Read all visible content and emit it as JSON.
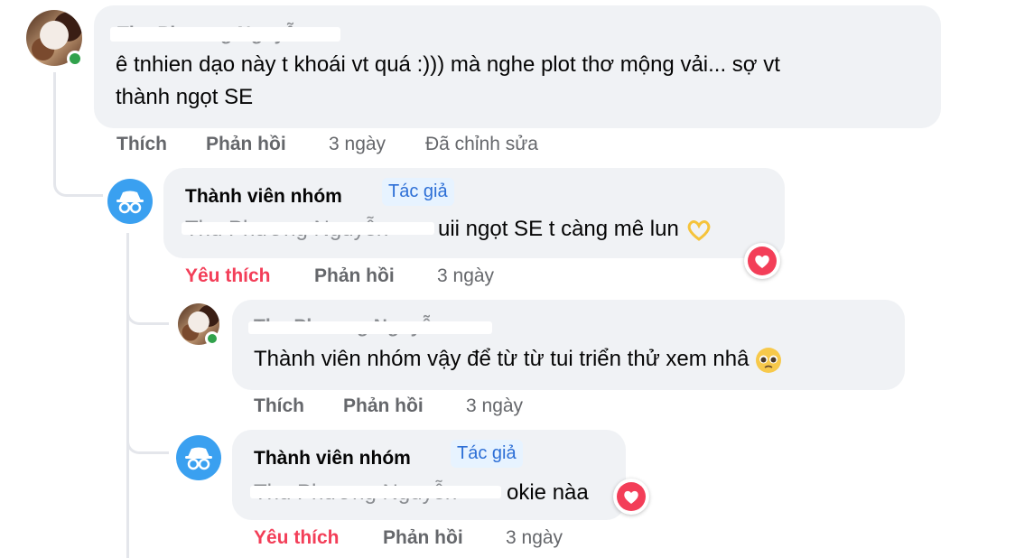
{
  "comments": [
    {
      "author": "Thu Phương Nguyễn",
      "text_line1": "ê tnhien dạo này t khoái vt quá :))) mà nghe plot thơ mộng vải... sợ vt",
      "text_line2": "thành ngọt SE",
      "actions": {
        "like": "Thích",
        "reply": "Phản hồi",
        "time": "3 ngày",
        "edited": "Đã chỉnh sửa"
      }
    },
    {
      "author": "Thành viên nhóm",
      "badge": "Tác giả",
      "mention": "Thu Phương Nguyễn",
      "text": "uii ngọt SE t càng mê lun",
      "actions": {
        "like": "Yêu thích",
        "reply": "Phản hồi",
        "time": "3 ngày"
      },
      "reaction_icon": "heart-reaction-icon",
      "text_emoji": "heart-hands-emoji"
    },
    {
      "author": "Thu Phương Nguyễn",
      "text": "Thành viên nhóm vậy để từ từ tui triển thử xem nhâ",
      "actions": {
        "like": "Thích",
        "reply": "Phản hồi",
        "time": "3 ngày"
      },
      "text_emoji": "pleading-face-emoji"
    },
    {
      "author": "Thành viên nhóm",
      "badge": "Tác giả",
      "mention": "Thu Phương Nguyễn",
      "text": "okie nàa",
      "actions": {
        "like": "Yêu thích",
        "reply": "Phản hồi",
        "time": "3 ngày"
      },
      "reaction_icon": "heart-reaction-icon"
    }
  ],
  "colors": {
    "bubble": "#f0f2f5",
    "action_gray": "#65676b",
    "liked_red": "#f33e58",
    "badge_blue": "#2d6fd6",
    "online_green": "#31a24c"
  }
}
